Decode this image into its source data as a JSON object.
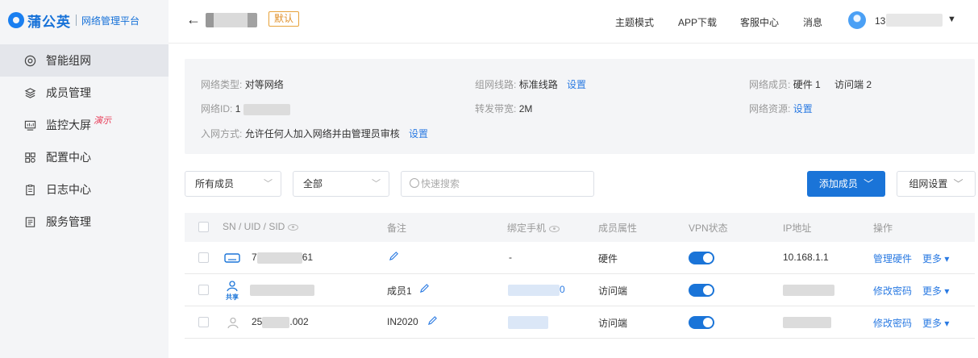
{
  "brand": {
    "name": "蒲公英",
    "subtitle": "网络管理平台"
  },
  "sidebar": {
    "items": [
      {
        "label": "智能组网",
        "icon": "target-icon",
        "active": true
      },
      {
        "label": "成员管理",
        "icon": "layers-icon"
      },
      {
        "label": "监控大屏",
        "icon": "monitor-icon",
        "badge": "演示"
      },
      {
        "label": "配置中心",
        "icon": "grid-icon"
      },
      {
        "label": "日志中心",
        "icon": "clipboard-icon"
      },
      {
        "label": "服务管理",
        "icon": "list-icon"
      }
    ]
  },
  "header": {
    "back_icon": "←",
    "tag": "默认",
    "nav": [
      "主题模式",
      "APP下载",
      "客服中心",
      "消息"
    ],
    "user_prefix": "13",
    "caret": "▼"
  },
  "info": {
    "type_label": "网络类型:",
    "type_value": "对等网络",
    "line_label": "组网线路:",
    "line_value": "标准线路",
    "line_link": "设置",
    "members_label": "网络成员:",
    "members_value": "硬件 1",
    "members_value2": "访问端 2",
    "id_label": "网络ID:",
    "id_prefix": "1",
    "bw_label": "转发带宽:",
    "bw_value": "2M",
    "res_label": "网络资源:",
    "res_link": "设置",
    "join_label": "入网方式:",
    "join_value": "允许任何人加入网络并由管理员审核",
    "join_link": "设置"
  },
  "toolbar": {
    "member_filter": "所有成员",
    "status_filter": "全部",
    "search_placeholder": "快速搜索",
    "add_button": "添加成员",
    "network_settings": "组网设置"
  },
  "table": {
    "headers": [
      "SN / UID / SID",
      "备注",
      "绑定手机",
      "成员属性",
      "VPN状态",
      "IP地址",
      "操作"
    ],
    "rows": [
      {
        "id_prefix": "7",
        "id_suffix": "61",
        "note": "",
        "phone": "-",
        "type": "硬件",
        "vpn": true,
        "ip": "10.168.1.1",
        "action": "管理硬件",
        "more": "更多"
      },
      {
        "id_prefix": "",
        "id_suffix": "",
        "share": "共享",
        "note": "成员1",
        "phone": "",
        "phone_suffix": "0",
        "type": "访问端",
        "vpn": true,
        "ip": "",
        "action": "修改密码",
        "more": "更多"
      },
      {
        "id_prefix": "25",
        "id_suffix": ".002",
        "note": "IN2020",
        "phone": "",
        "type": "访问端",
        "vpn": true,
        "ip": "",
        "action": "修改密码",
        "more": "更多"
      }
    ]
  },
  "colors": {
    "primary": "#1a74d8",
    "link": "#2a7ae2",
    "tag": "#e0902a",
    "badge": "#e83a56"
  }
}
